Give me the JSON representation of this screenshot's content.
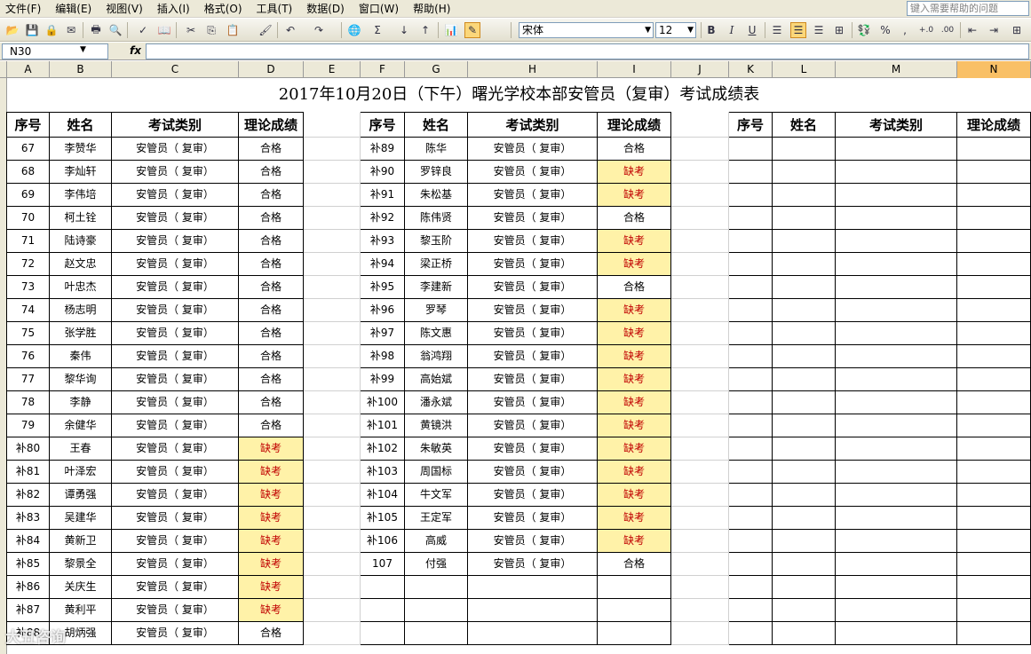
{
  "menubar": {
    "items": [
      "文件(F)",
      "编辑(E)",
      "视图(V)",
      "插入(I)",
      "格式(O)",
      "工具(T)",
      "数据(D)",
      "窗口(W)",
      "帮助(H)"
    ],
    "help_placeholder": "键入需要帮助的问题"
  },
  "toolbar": {
    "font_name": "宋体",
    "font_size": "12"
  },
  "formula": {
    "name_box": "N30",
    "fx": "fx",
    "content": ""
  },
  "columns": [
    "A",
    "B",
    "C",
    "D",
    "E",
    "F",
    "G",
    "H",
    "I",
    "J",
    "K",
    "L",
    "M",
    "N"
  ],
  "sheet": {
    "title": "2017年10月20日（下午）曙光学校本部安管员（复审）考试成绩表",
    "headers": [
      "序号",
      "姓名",
      "考试类别",
      "理论成绩"
    ],
    "left_rows": [
      {
        "no": "67",
        "name": "李赞华",
        "type": "安管员（ 复审）",
        "score": "合格"
      },
      {
        "no": "68",
        "name": "李灿轩",
        "type": "安管员（ 复审）",
        "score": "合格"
      },
      {
        "no": "69",
        "name": "李伟培",
        "type": "安管员（ 复审）",
        "score": "合格"
      },
      {
        "no": "70",
        "name": "柯土铨",
        "type": "安管员（ 复审）",
        "score": "合格"
      },
      {
        "no": "71",
        "name": "陆诗豪",
        "type": "安管员（ 复审）",
        "score": "合格"
      },
      {
        "no": "72",
        "name": "赵文忠",
        "type": "安管员（ 复审）",
        "score": "合格"
      },
      {
        "no": "73",
        "name": "叶忠杰",
        "type": "安管员（ 复审）",
        "score": "合格"
      },
      {
        "no": "74",
        "name": "杨志明",
        "type": "安管员（ 复审）",
        "score": "合格"
      },
      {
        "no": "75",
        "name": "张学胜",
        "type": "安管员（ 复审）",
        "score": "合格"
      },
      {
        "no": "76",
        "name": "秦伟",
        "type": "安管员（ 复审）",
        "score": "合格"
      },
      {
        "no": "77",
        "name": "黎华询",
        "type": "安管员（ 复审）",
        "score": "合格"
      },
      {
        "no": "78",
        "name": "李静",
        "type": "安管员（ 复审）",
        "score": "合格"
      },
      {
        "no": "79",
        "name": "余健华",
        "type": "安管员（ 复审）",
        "score": "合格"
      },
      {
        "no": "补80",
        "name": "王春",
        "type": "安管员（ 复审）",
        "score": "缺考"
      },
      {
        "no": "补81",
        "name": "叶泽宏",
        "type": "安管员（ 复审）",
        "score": "缺考"
      },
      {
        "no": "补82",
        "name": "谭勇强",
        "type": "安管员（ 复审）",
        "score": "缺考"
      },
      {
        "no": "补83",
        "name": "吴建华",
        "type": "安管员（ 复审）",
        "score": "缺考"
      },
      {
        "no": "补84",
        "name": "黄新卫",
        "type": "安管员（ 复审）",
        "score": "缺考"
      },
      {
        "no": "补85",
        "name": "黎景全",
        "type": "安管员（ 复审）",
        "score": "缺考"
      },
      {
        "no": "补86",
        "name": "关庆生",
        "type": "安管员（ 复审）",
        "score": "缺考"
      },
      {
        "no": "补87",
        "name": "黄利平",
        "type": "安管员（ 复审）",
        "score": "缺考"
      },
      {
        "no": "补88",
        "name": "胡炳强",
        "type": "安管员（ 复审）",
        "score": "合格"
      }
    ],
    "middle_rows": [
      {
        "no": "补89",
        "name": "陈华",
        "type": "安管员（ 复审）",
        "score": "合格"
      },
      {
        "no": "补90",
        "name": "罗锌良",
        "type": "安管员（ 复审）",
        "score": "缺考"
      },
      {
        "no": "补91",
        "name": "朱松基",
        "type": "安管员（ 复审）",
        "score": "缺考"
      },
      {
        "no": "补92",
        "name": "陈伟贤",
        "type": "安管员（ 复审）",
        "score": "合格"
      },
      {
        "no": "补93",
        "name": "黎玉阶",
        "type": "安管员（ 复审）",
        "score": "缺考"
      },
      {
        "no": "补94",
        "name": "梁正桥",
        "type": "安管员（ 复审）",
        "score": "缺考"
      },
      {
        "no": "补95",
        "name": "李建新",
        "type": "安管员（ 复审）",
        "score": "合格"
      },
      {
        "no": "补96",
        "name": "罗琴",
        "type": "安管员（ 复审）",
        "score": "缺考"
      },
      {
        "no": "补97",
        "name": "陈文惠",
        "type": "安管员（ 复审）",
        "score": "缺考"
      },
      {
        "no": "补98",
        "name": "翁鸿翔",
        "type": "安管员（ 复审）",
        "score": "缺考"
      },
      {
        "no": "补99",
        "name": "高始斌",
        "type": "安管员（ 复审）",
        "score": "缺考"
      },
      {
        "no": "补100",
        "name": "潘永斌",
        "type": "安管员（ 复审）",
        "score": "缺考"
      },
      {
        "no": "补101",
        "name": "黄镜洪",
        "type": "安管员（ 复审）",
        "score": "缺考"
      },
      {
        "no": "补102",
        "name": "朱敏英",
        "type": "安管员（ 复审）",
        "score": "缺考"
      },
      {
        "no": "补103",
        "name": "周国标",
        "type": "安管员（ 复审）",
        "score": "缺考"
      },
      {
        "no": "补104",
        "name": "牛文军",
        "type": "安管员（ 复审）",
        "score": "缺考"
      },
      {
        "no": "补105",
        "name": "王定军",
        "type": "安管员（ 复审）",
        "score": "缺考"
      },
      {
        "no": "补106",
        "name": "高威",
        "type": "安管员（ 复审）",
        "score": "缺考"
      },
      {
        "no": "107",
        "name": "付强",
        "type": "安管员（ 复审）",
        "score": "合格"
      }
    ],
    "missing_label": "缺考",
    "missing_color": "#c00000",
    "missing_fill": "#fff2a8"
  },
  "watermark": "大丑咨询"
}
